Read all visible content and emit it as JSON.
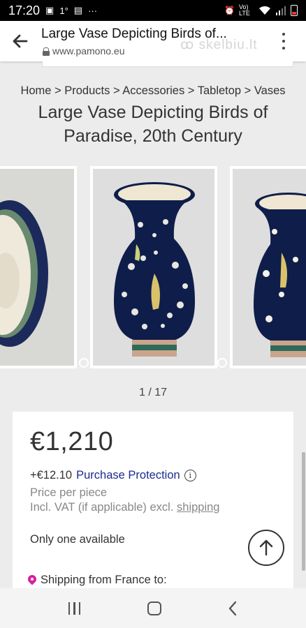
{
  "status_bar": {
    "time": "17:20",
    "temp": "1°",
    "more": "···",
    "network": "Vo) LTE"
  },
  "browser": {
    "title": "Large Vase Depicting Birds of...",
    "domain": "www.pamono.eu",
    "watermark": "ꝏ skelbiu.lt"
  },
  "breadcrumb": "Home > Products > Accessories > Tabletop > Vases",
  "product": {
    "title": "Large Vase Depicting Birds of Paradise, 20th Century",
    "counter": "1 / 17",
    "price": "€1,210",
    "protection_amount": "+€12.10",
    "protection_label": "Purchase Protection",
    "price_note": "Price per piece",
    "vat_text": "Incl. VAT (if applicable) excl.",
    "shipping_link": "shipping",
    "availability": "Only one available",
    "shipping_from": "Shipping from France to:"
  },
  "icons": {
    "back": "arrow-left-icon",
    "lock": "lock-icon",
    "menu": "more-vert-icon",
    "info": "info-icon",
    "pin": "location-pin-icon",
    "scroll_top": "arrow-up-icon"
  },
  "colors": {
    "link": "#1d2a8f",
    "pin": "#d6209f",
    "vase_blue": "#0f1d4a"
  }
}
